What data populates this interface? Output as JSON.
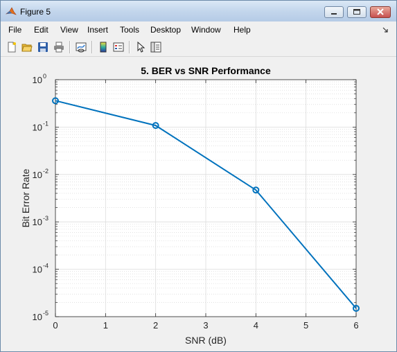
{
  "window": {
    "title": "Figure 5"
  },
  "menu": [
    "File",
    "Edit",
    "View",
    "Insert",
    "Tools",
    "Desktop",
    "Window",
    "Help"
  ],
  "toolbar": [
    "new-figure",
    "open-file",
    "save",
    "print",
    "link-plot",
    "insert-colorbar",
    "insert-legend",
    "edit-plot",
    "property-inspector"
  ],
  "chart_data": {
    "type": "line",
    "title": "5. BER vs SNR Performance",
    "xlabel": "SNR (dB)",
    "ylabel": "Bit Error Rate",
    "x_ticks": [
      "0",
      "1",
      "2",
      "3",
      "4",
      "5",
      "6"
    ],
    "y_ticks": [
      "10",
      "10",
      "10",
      "10",
      "10",
      "10"
    ],
    "y_tick_exponents": [
      "0",
      "-1",
      "-2",
      "-3",
      "-4",
      "-5"
    ],
    "xlim": [
      0,
      6
    ],
    "ylim": [
      1e-05,
      1
    ],
    "yscale": "log",
    "grid": "on (major and minor)",
    "marker": "circle",
    "color": "#0072bd",
    "series": [
      {
        "x": [
          0,
          2,
          4,
          6
        ],
        "y": [
          0.36,
          0.108,
          0.0047,
          1.5e-05
        ]
      }
    ]
  }
}
